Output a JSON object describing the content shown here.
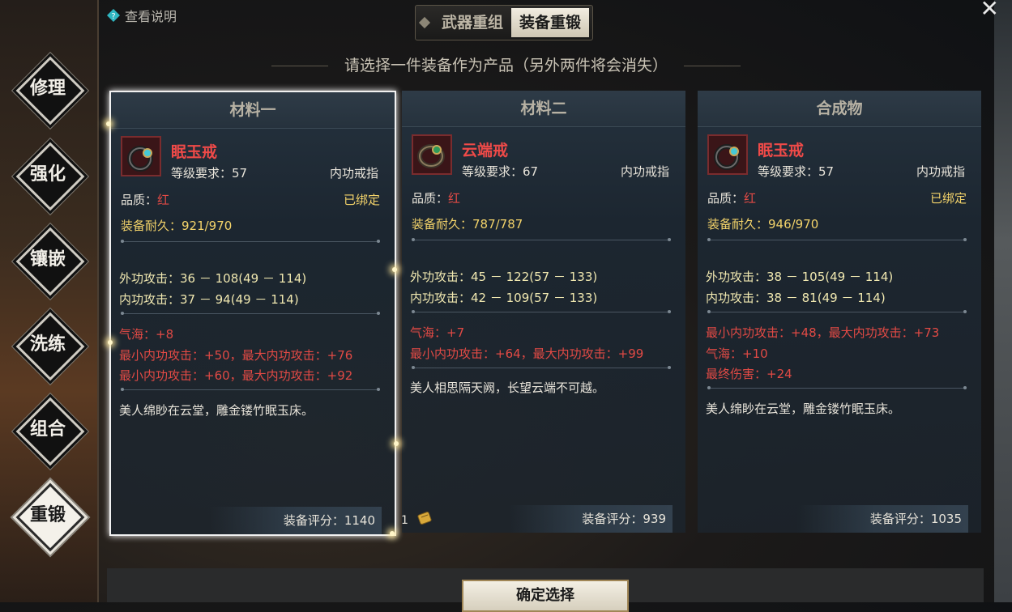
{
  "help": {
    "label": "查看说明"
  },
  "tabs": [
    {
      "label": "武器重组",
      "active": false
    },
    {
      "label": "装备重锻",
      "active": true
    }
  ],
  "subtitle": "请选择一件装备作为产品（另外两件将会消失）",
  "nav": [
    {
      "label": "修理",
      "active": false
    },
    {
      "label": "强化",
      "active": false
    },
    {
      "label": "镶嵌",
      "active": false
    },
    {
      "label": "洗练",
      "active": false
    },
    {
      "label": "组合",
      "active": false
    },
    {
      "label": "重锻",
      "active": true
    }
  ],
  "cards": [
    {
      "header": "材料一",
      "name": "眠玉戒",
      "req": "等级要求：57",
      "type": "内功戒指",
      "quality_label": "品质：",
      "quality": "红",
      "bound": "已绑定",
      "durability": "装备耐久：921/970",
      "attack_outer": "外功攻击：36 － 108",
      "attack_outer_range": "(49 － 114)",
      "attack_inner": "内功攻击：37 － 94",
      "attack_inner_range": "(49 － 114)",
      "bonuses": [
        "气海：+8",
        "最小内功攻击：+50，最大内功攻击：+76",
        "最小内功攻击：+60，最大内功攻击：+92"
      ],
      "flavor": "美人绵眇在云堂，雕金镂竹眠玉床。",
      "score": "装备评分：1140"
    },
    {
      "header": "材料二",
      "name": "云端戒",
      "req": "等级要求：67",
      "type": "内功戒指",
      "quality_label": "品质：",
      "quality": "红",
      "bound": "",
      "durability": "装备耐久：787/787",
      "attack_outer": "外功攻击：45 － 122",
      "attack_outer_range": "(57 － 133)",
      "attack_inner": "内功攻击：42 － 109",
      "attack_inner_range": "(57 － 133)",
      "bonuses": [
        "气海：+7",
        "最小内功攻击：+64，最大内功攻击：+99"
      ],
      "flavor": "美人相思隔天阙，长望云端不可越。",
      "score": "装备评分：939"
    },
    {
      "header": "合成物",
      "name": "眠玉戒",
      "req": "等级要求：57",
      "type": "内功戒指",
      "quality_label": "品质：",
      "quality": "红",
      "bound": "已绑定",
      "durability": "装备耐久：946/970",
      "attack_outer": "外功攻击：38 － 105",
      "attack_outer_range": "(49 － 114)",
      "attack_inner": "内功攻击：38 － 81",
      "attack_inner_range": "(49 － 114)",
      "bonuses": [
        "最小内功攻击：+48，最大内功攻击：+73",
        "气海：+10",
        "最终伤害：+24"
      ],
      "flavor": "美人绵眇在云堂，雕金镂竹眠玉床。",
      "score": "装备评分：1035"
    }
  ],
  "scroll_qty": "1",
  "confirm_label": "确定选择",
  "colors": {
    "accent_red": "#e24a45",
    "gold": "#f3d36a",
    "attack_text": "#f0e8b0"
  }
}
